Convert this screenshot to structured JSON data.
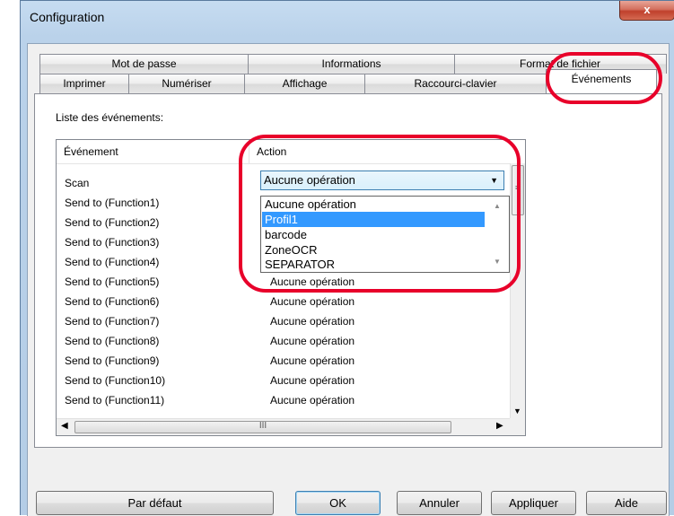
{
  "window": {
    "title": "Configuration",
    "close_label": "x"
  },
  "tabs": {
    "back_row": [
      "Mot de passe",
      "Informations",
      "Format de fichier"
    ],
    "front_row": [
      "Imprimer",
      "Numériser",
      "Affichage",
      "Raccourci-clavier",
      "Événements"
    ],
    "active": "Événements"
  },
  "events": {
    "list_label": "Liste des événements:",
    "columns": [
      "Événement",
      "Action"
    ],
    "rows": [
      {
        "event": "Scan",
        "action": ""
      },
      {
        "event": "Send to (Function1)",
        "action": ""
      },
      {
        "event": "Send to (Function2)",
        "action": ""
      },
      {
        "event": "Send to (Function3)",
        "action": ""
      },
      {
        "event": "Send to (Function4)",
        "action": ""
      },
      {
        "event": "Send to (Function5)",
        "action": "Aucune opération"
      },
      {
        "event": "Send to (Function6)",
        "action": "Aucune opération"
      },
      {
        "event": "Send to (Function7)",
        "action": "Aucune opération"
      },
      {
        "event": "Send to (Function8)",
        "action": "Aucune opération"
      },
      {
        "event": "Send to (Function9)",
        "action": "Aucune opération"
      },
      {
        "event": "Send to (Function10)",
        "action": "Aucune opération"
      },
      {
        "event": "Send to (Function11)",
        "action": "Aucune opération"
      }
    ],
    "scrollbar_grip": "≡",
    "hscroll_grip": "III"
  },
  "action_dropdown": {
    "selected": "Aucune opération",
    "options": [
      "Aucune opération",
      "Profil1",
      "barcode",
      "ZoneOCR",
      "SEPARATOR"
    ],
    "highlighted_index": 1
  },
  "buttons": {
    "default": "Par défaut",
    "ok": "OK",
    "cancel": "Annuler",
    "apply": "Appliquer",
    "help": "Aide"
  },
  "colors": {
    "highlight": "#3399ff",
    "annotation": "#e8002a"
  },
  "icons": {
    "close": "close-icon",
    "dropdown": "chevron-down-icon"
  }
}
